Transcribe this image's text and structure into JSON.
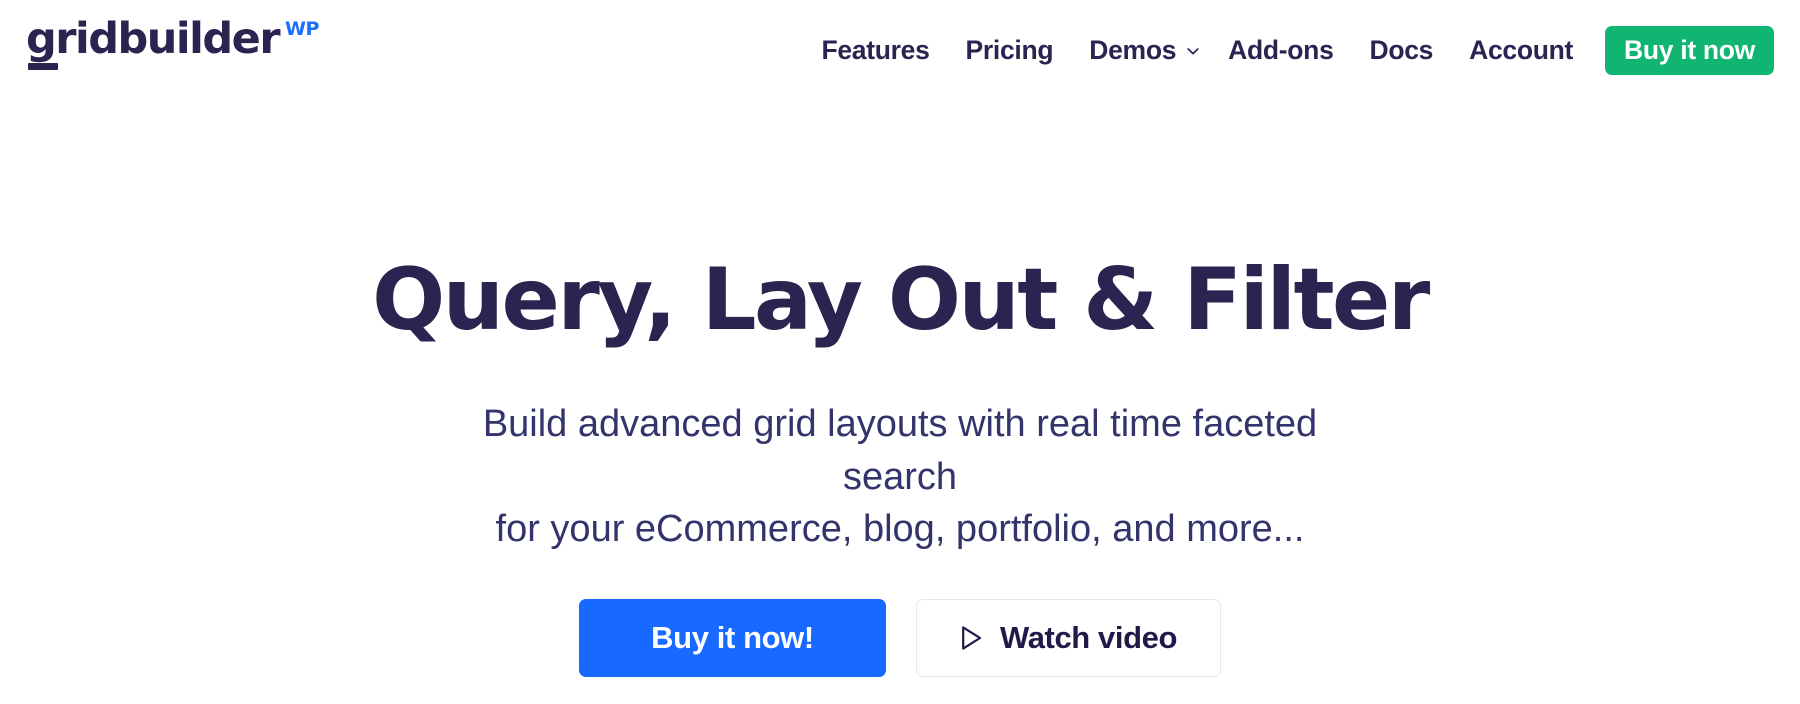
{
  "header": {
    "logo": {
      "wordmark": "gridbuilder",
      "suffix": "WP",
      "wordmark_color": "#2B2350",
      "suffix_color": "#1a6dff"
    },
    "nav": {
      "items": [
        {
          "label": "Features",
          "has_dropdown": false
        },
        {
          "label": "Pricing",
          "has_dropdown": false
        },
        {
          "label": "Demos",
          "has_dropdown": true,
          "dropdown_icon": "chevron-down-icon"
        },
        {
          "label": "Add-ons",
          "has_dropdown": false
        },
        {
          "label": "Docs",
          "has_dropdown": false
        },
        {
          "label": "Account",
          "has_dropdown": false
        }
      ],
      "cta": {
        "label": "Buy it now",
        "color": "#0FB571"
      }
    }
  },
  "hero": {
    "title": "Query, Lay Out & Filter",
    "title_color": "#2B2350",
    "subtitle_line1": "Build advanced grid layouts with real time faceted search",
    "subtitle_line2": "for your eCommerce, blog, portfolio, and more...",
    "subtitle_color": "#33346B",
    "actions": {
      "primary": {
        "label": "Buy it now!",
        "color": "#1769FF"
      },
      "secondary": {
        "label": "Watch video",
        "icon": "play-icon",
        "border_color": "#E3E9F5"
      }
    }
  }
}
